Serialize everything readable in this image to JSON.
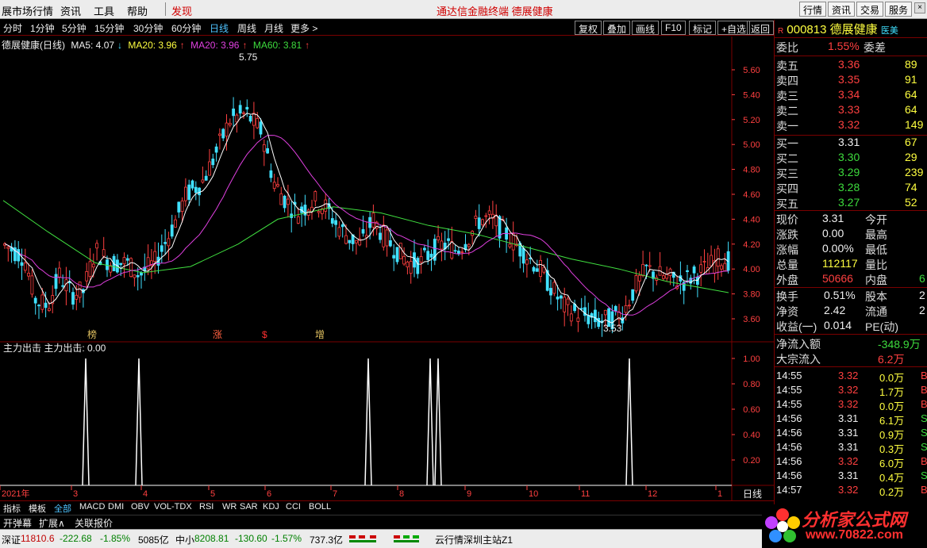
{
  "menubar": {
    "items": [
      "展市场行情",
      "资讯",
      "工具",
      "帮助",
      "发现"
    ],
    "center_text": "通达信金融终端   德展健康",
    "right_buttons": [
      "行情",
      "资讯",
      "交易",
      "服务"
    ]
  },
  "toolbar": {
    "periods": [
      "分时",
      "1分钟",
      "5分钟",
      "15分钟",
      "30分钟",
      "60分钟",
      "日线",
      "周线",
      "月线",
      "更多 >"
    ],
    "active": "日线",
    "actions": [
      "复权",
      "叠加",
      "画线",
      "F10",
      "标记",
      "+自选",
      "返回"
    ]
  },
  "legend": {
    "name": "德展健康(日线)",
    "ma5": "MA5: 4.07",
    "ma20a": "MA20: 3.96",
    "ma20b": "MA20: 3.96",
    "ma60": "MA60: 3.81"
  },
  "indicator": {
    "title": "主力出击  主力出击: 0.00",
    "yticks": [
      "1.00",
      "0.80",
      "0.60",
      "0.40",
      "0.20"
    ]
  },
  "price_axis": [
    "5.60",
    "5.40",
    "5.20",
    "5.00",
    "4.80",
    "4.60",
    "4.40",
    "4.20",
    "4.00",
    "3.80",
    "3.60"
  ],
  "annotations": {
    "high": "5.75",
    "low": "3.53",
    "markers": [
      "榜",
      "涨",
      "$",
      "增"
    ]
  },
  "time_axis": {
    "labels": [
      "2021年",
      "3",
      "4",
      "5",
      "6",
      "7",
      "8",
      "9",
      "10",
      "11",
      "12",
      "1"
    ],
    "period_label": "日线"
  },
  "quote": {
    "code": "000813",
    "name": "德展健康",
    "tag": "医美",
    "weibi_label": "委比",
    "weibi": "1.55%",
    "weicha_label": "委差",
    "asks": [
      {
        "label": "卖五",
        "price": "3.36",
        "vol": "89"
      },
      {
        "label": "卖四",
        "price": "3.35",
        "vol": "91"
      },
      {
        "label": "卖三",
        "price": "3.34",
        "vol": "64"
      },
      {
        "label": "卖二",
        "price": "3.33",
        "vol": "64"
      },
      {
        "label": "卖一",
        "price": "3.32",
        "vol": "149"
      }
    ],
    "bids": [
      {
        "label": "买一",
        "price": "3.31",
        "vol": "67"
      },
      {
        "label": "买二",
        "price": "3.30",
        "vol": "29"
      },
      {
        "label": "买三",
        "price": "3.29",
        "vol": "239"
      },
      {
        "label": "买四",
        "price": "3.28",
        "vol": "74"
      },
      {
        "label": "买五",
        "price": "3.27",
        "vol": "52"
      }
    ],
    "stats": [
      {
        "label": "现价",
        "value": "3.31",
        "label2": "今开"
      },
      {
        "label": "涨跌",
        "value": "0.00",
        "label2": "最高"
      },
      {
        "label": "涨幅",
        "value": "0.00%",
        "label2": "最低"
      },
      {
        "label": "总量",
        "value": "112117",
        "label2": "量比"
      },
      {
        "label": "外盘",
        "value": "50666",
        "label2": "内盘",
        "value2": "6"
      }
    ],
    "stats2": [
      {
        "label": "换手",
        "value": "0.51%",
        "label2": "股本",
        "value2": "2"
      },
      {
        "label": "净资",
        "value": "2.42",
        "label2": "流通",
        "value2": "2"
      },
      {
        "label": "收益(一)",
        "value": "0.014",
        "label2": "PE(动)"
      }
    ],
    "flow": [
      {
        "label": "净流入额",
        "value": "-348.9万"
      },
      {
        "label": "大宗流入",
        "value": "6.2万"
      }
    ],
    "ticks": [
      {
        "time": "14:55",
        "price": "3.32",
        "vol": "0.0万",
        "bs": "B",
        "up": true
      },
      {
        "time": "14:55",
        "price": "3.32",
        "vol": "1.7万",
        "bs": "B",
        "up": true
      },
      {
        "time": "14:55",
        "price": "3.32",
        "vol": "0.0万",
        "bs": "B",
        "up": true
      },
      {
        "time": "14:56",
        "price": "3.31",
        "vol": "6.1万",
        "bs": "S",
        "up": false
      },
      {
        "time": "14:56",
        "price": "3.31",
        "vol": "0.9万",
        "bs": "S",
        "up": false
      },
      {
        "time": "14:56",
        "price": "3.31",
        "vol": "0.3万",
        "bs": "S",
        "up": false
      },
      {
        "time": "14:56",
        "price": "3.32",
        "vol": "6.0万",
        "bs": "B",
        "up": true
      },
      {
        "time": "14:56",
        "price": "3.31",
        "vol": "0.4万",
        "bs": "S",
        "up": false
      },
      {
        "time": "14:57",
        "price": "3.32",
        "vol": "0.2万",
        "bs": "B",
        "up": true
      }
    ]
  },
  "tabs": [
    "指标",
    "模板",
    "全部",
    "MACD",
    "DMI",
    "OBV",
    "VOL-TDX",
    "RSI",
    "WR",
    "SAR",
    "KDJ",
    "CCI",
    "BOLL"
  ],
  "tabs_active": "全部",
  "tabs2": [
    "开弹幕",
    "扩展∧",
    "关联报价"
  ],
  "status": {
    "sz": "深证",
    "sz_val": "11810.6",
    "sz_chg": "-222.68",
    "sz_pct": "-1.85%",
    "sz_amt": "5085亿",
    "zx": "中小",
    "zx_val": "8208.81",
    "zx_chg": "-130.60",
    "zx_pct": "-1.57%",
    "zx_amt": "737.3亿",
    "server": "云行情深圳主站Z1"
  },
  "logo": {
    "name": "分析家公式网",
    "url": "www.70822.com"
  },
  "colors": {
    "up": "#ff4040",
    "down": "#40e0ff",
    "ma5": "#ffffff",
    "ma20": "#e040e0",
    "ma60": "#40e040",
    "grid": "#7a0000"
  }
}
